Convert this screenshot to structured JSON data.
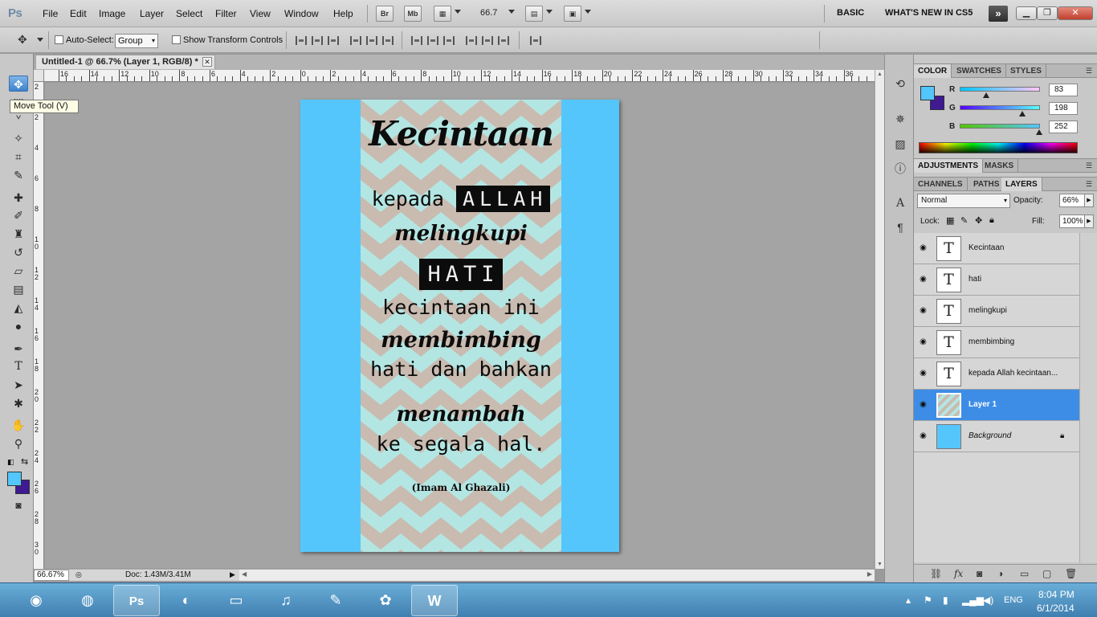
{
  "app": {
    "logo": "Ps"
  },
  "menu": [
    "File",
    "Edit",
    "Image",
    "Layer",
    "Select",
    "Filter",
    "View",
    "Window",
    "Help"
  ],
  "menubar_buttons": {
    "bridge": "Br",
    "mini_bridge": "Mb",
    "zoom": "66.7"
  },
  "workspace": {
    "basic": "BASIC",
    "whats_new": "WHAT'S NEW IN CS5",
    "more": "»"
  },
  "options": {
    "auto_select_label": "Auto-Select:",
    "auto_select_value": "Group",
    "transform_label": "Show Transform Controls"
  },
  "tooltip": "Move Tool (V)",
  "tools": [
    {
      "name": "move-tool",
      "icon": "move-icon",
      "glyph": "✥"
    },
    {
      "name": "marquee-tool",
      "icon": "marquee-icon",
      "glyph": "⬚"
    },
    {
      "name": "lasso-tool",
      "icon": "lasso-icon",
      "glyph": "ᘁ"
    },
    {
      "name": "quick-select-tool",
      "icon": "magic-wand-icon",
      "glyph": "✧"
    },
    {
      "name": "crop-tool",
      "icon": "crop-icon",
      "glyph": "⌗"
    },
    {
      "name": "eyedropper-tool",
      "icon": "eyedropper-icon",
      "glyph": "✎"
    },
    {
      "name": "healing-tool",
      "icon": "bandage-icon",
      "glyph": "✚"
    },
    {
      "name": "brush-tool",
      "icon": "brush-icon",
      "glyph": "✐"
    },
    {
      "name": "stamp-tool",
      "icon": "stamp-icon",
      "glyph": "♜"
    },
    {
      "name": "history-brush-tool",
      "icon": "history-brush-icon",
      "glyph": "↺"
    },
    {
      "name": "eraser-tool",
      "icon": "eraser-icon",
      "glyph": "▱"
    },
    {
      "name": "gradient-tool",
      "icon": "gradient-icon",
      "glyph": "▤"
    },
    {
      "name": "blur-tool",
      "icon": "blur-icon",
      "glyph": "◭"
    },
    {
      "name": "dodge-tool",
      "icon": "dodge-icon",
      "glyph": "●"
    },
    {
      "name": "pen-tool",
      "icon": "pen-icon",
      "glyph": "✒"
    },
    {
      "name": "type-tool",
      "icon": "type-icon",
      "glyph": "T"
    },
    {
      "name": "path-select-tool",
      "icon": "path-select-icon",
      "glyph": "➤"
    },
    {
      "name": "shape-tool",
      "icon": "shape-icon",
      "glyph": "✱"
    },
    {
      "name": "hand-tool",
      "icon": "hand-icon",
      "glyph": "✋"
    },
    {
      "name": "zoom-tool",
      "icon": "zoom-icon",
      "glyph": "⚲"
    }
  ],
  "document": {
    "tab_title": "Untitled-1 @ 66.7% (Layer 1, RGB/8) *"
  },
  "rulers": {
    "top": [
      "16",
      "14",
      "12",
      "10",
      "8",
      "6",
      "4",
      "2",
      "0",
      "2",
      "4",
      "6",
      "8",
      "10",
      "12",
      "14",
      "16",
      "18",
      "20",
      "22",
      "24",
      "26",
      "28",
      "30",
      "32",
      "34",
      "36"
    ],
    "left": [
      "2",
      "2",
      "4",
      "6",
      "8",
      "1 0",
      "1 2",
      "1 4",
      "1 6",
      "1 8",
      "2 0",
      "2 2",
      "2 4",
      "2 6",
      "2 8",
      "3 0"
    ]
  },
  "status": {
    "zoom": "66.67%",
    "doc": "Doc: 1.43M/3.41M"
  },
  "poster": {
    "line1": "Kecintaan",
    "line2_plain": "kepada",
    "line2_box": "ALLAH",
    "line3": "melingkupi",
    "line4_box": "HATI",
    "line5": "kecintaan ini",
    "line6": "membimbing",
    "line7": "hati dan bahkan",
    "line8": "menambah",
    "line9": "ke segala hal.",
    "credit": "(Imam Al Ghazali)"
  },
  "colors": {
    "poster_bg": "#55c6fc",
    "pattern_a": "#c9bbb0",
    "pattern_b": "#b3e6e3",
    "foreground": "#53c6fc",
    "background": "#3f1a92",
    "selection": "#3d8de6"
  },
  "color_panel": {
    "tabs": [
      "COLOR",
      "SWATCHES",
      "STYLES"
    ],
    "sliders": [
      {
        "label": "R",
        "value": "83",
        "fraction": 0.325
      },
      {
        "label": "G",
        "value": "198",
        "fraction": 0.776
      },
      {
        "label": "B",
        "value": "252",
        "fraction": 0.988
      }
    ]
  },
  "adjust_tabs": [
    "ADJUSTMENTS",
    "MASKS"
  ],
  "layers_panel": {
    "tabs": [
      "CHANNELS",
      "PATHS",
      "LAYERS"
    ],
    "blend_mode": "Normal",
    "opacity_label": "Opacity:",
    "opacity": "66%",
    "lock_label": "Lock:",
    "fill_label": "Fill:",
    "fill": "100%",
    "layers": [
      {
        "name": "Kecintaan",
        "type": "text",
        "thumb": "T"
      },
      {
        "name": "hati",
        "type": "text",
        "thumb": "T"
      },
      {
        "name": "melingkupi",
        "type": "text",
        "thumb": "T"
      },
      {
        "name": "membimbing",
        "type": "text",
        "thumb": "T"
      },
      {
        "name": "kepada Allah    kecintaan...",
        "type": "text",
        "thumb": "T"
      },
      {
        "name": "Layer 1",
        "type": "pattern",
        "thumb": ""
      },
      {
        "name": "Background",
        "type": "fill",
        "thumb": ""
      }
    ]
  },
  "taskbar": {
    "apps": [
      {
        "name": "start",
        "glyph": "◉"
      },
      {
        "name": "chrome",
        "glyph": "◍"
      },
      {
        "name": "photoshop",
        "glyph": "Ps"
      },
      {
        "name": "firefox",
        "glyph": "◐"
      },
      {
        "name": "explorer",
        "glyph": "▭"
      },
      {
        "name": "music",
        "glyph": "♫"
      },
      {
        "name": "notepad",
        "glyph": "✎"
      },
      {
        "name": "paint",
        "glyph": "✿"
      },
      {
        "name": "word",
        "glyph": "W"
      }
    ],
    "lang": "ENG",
    "time": "8:04 PM",
    "date": "6/1/2014"
  }
}
